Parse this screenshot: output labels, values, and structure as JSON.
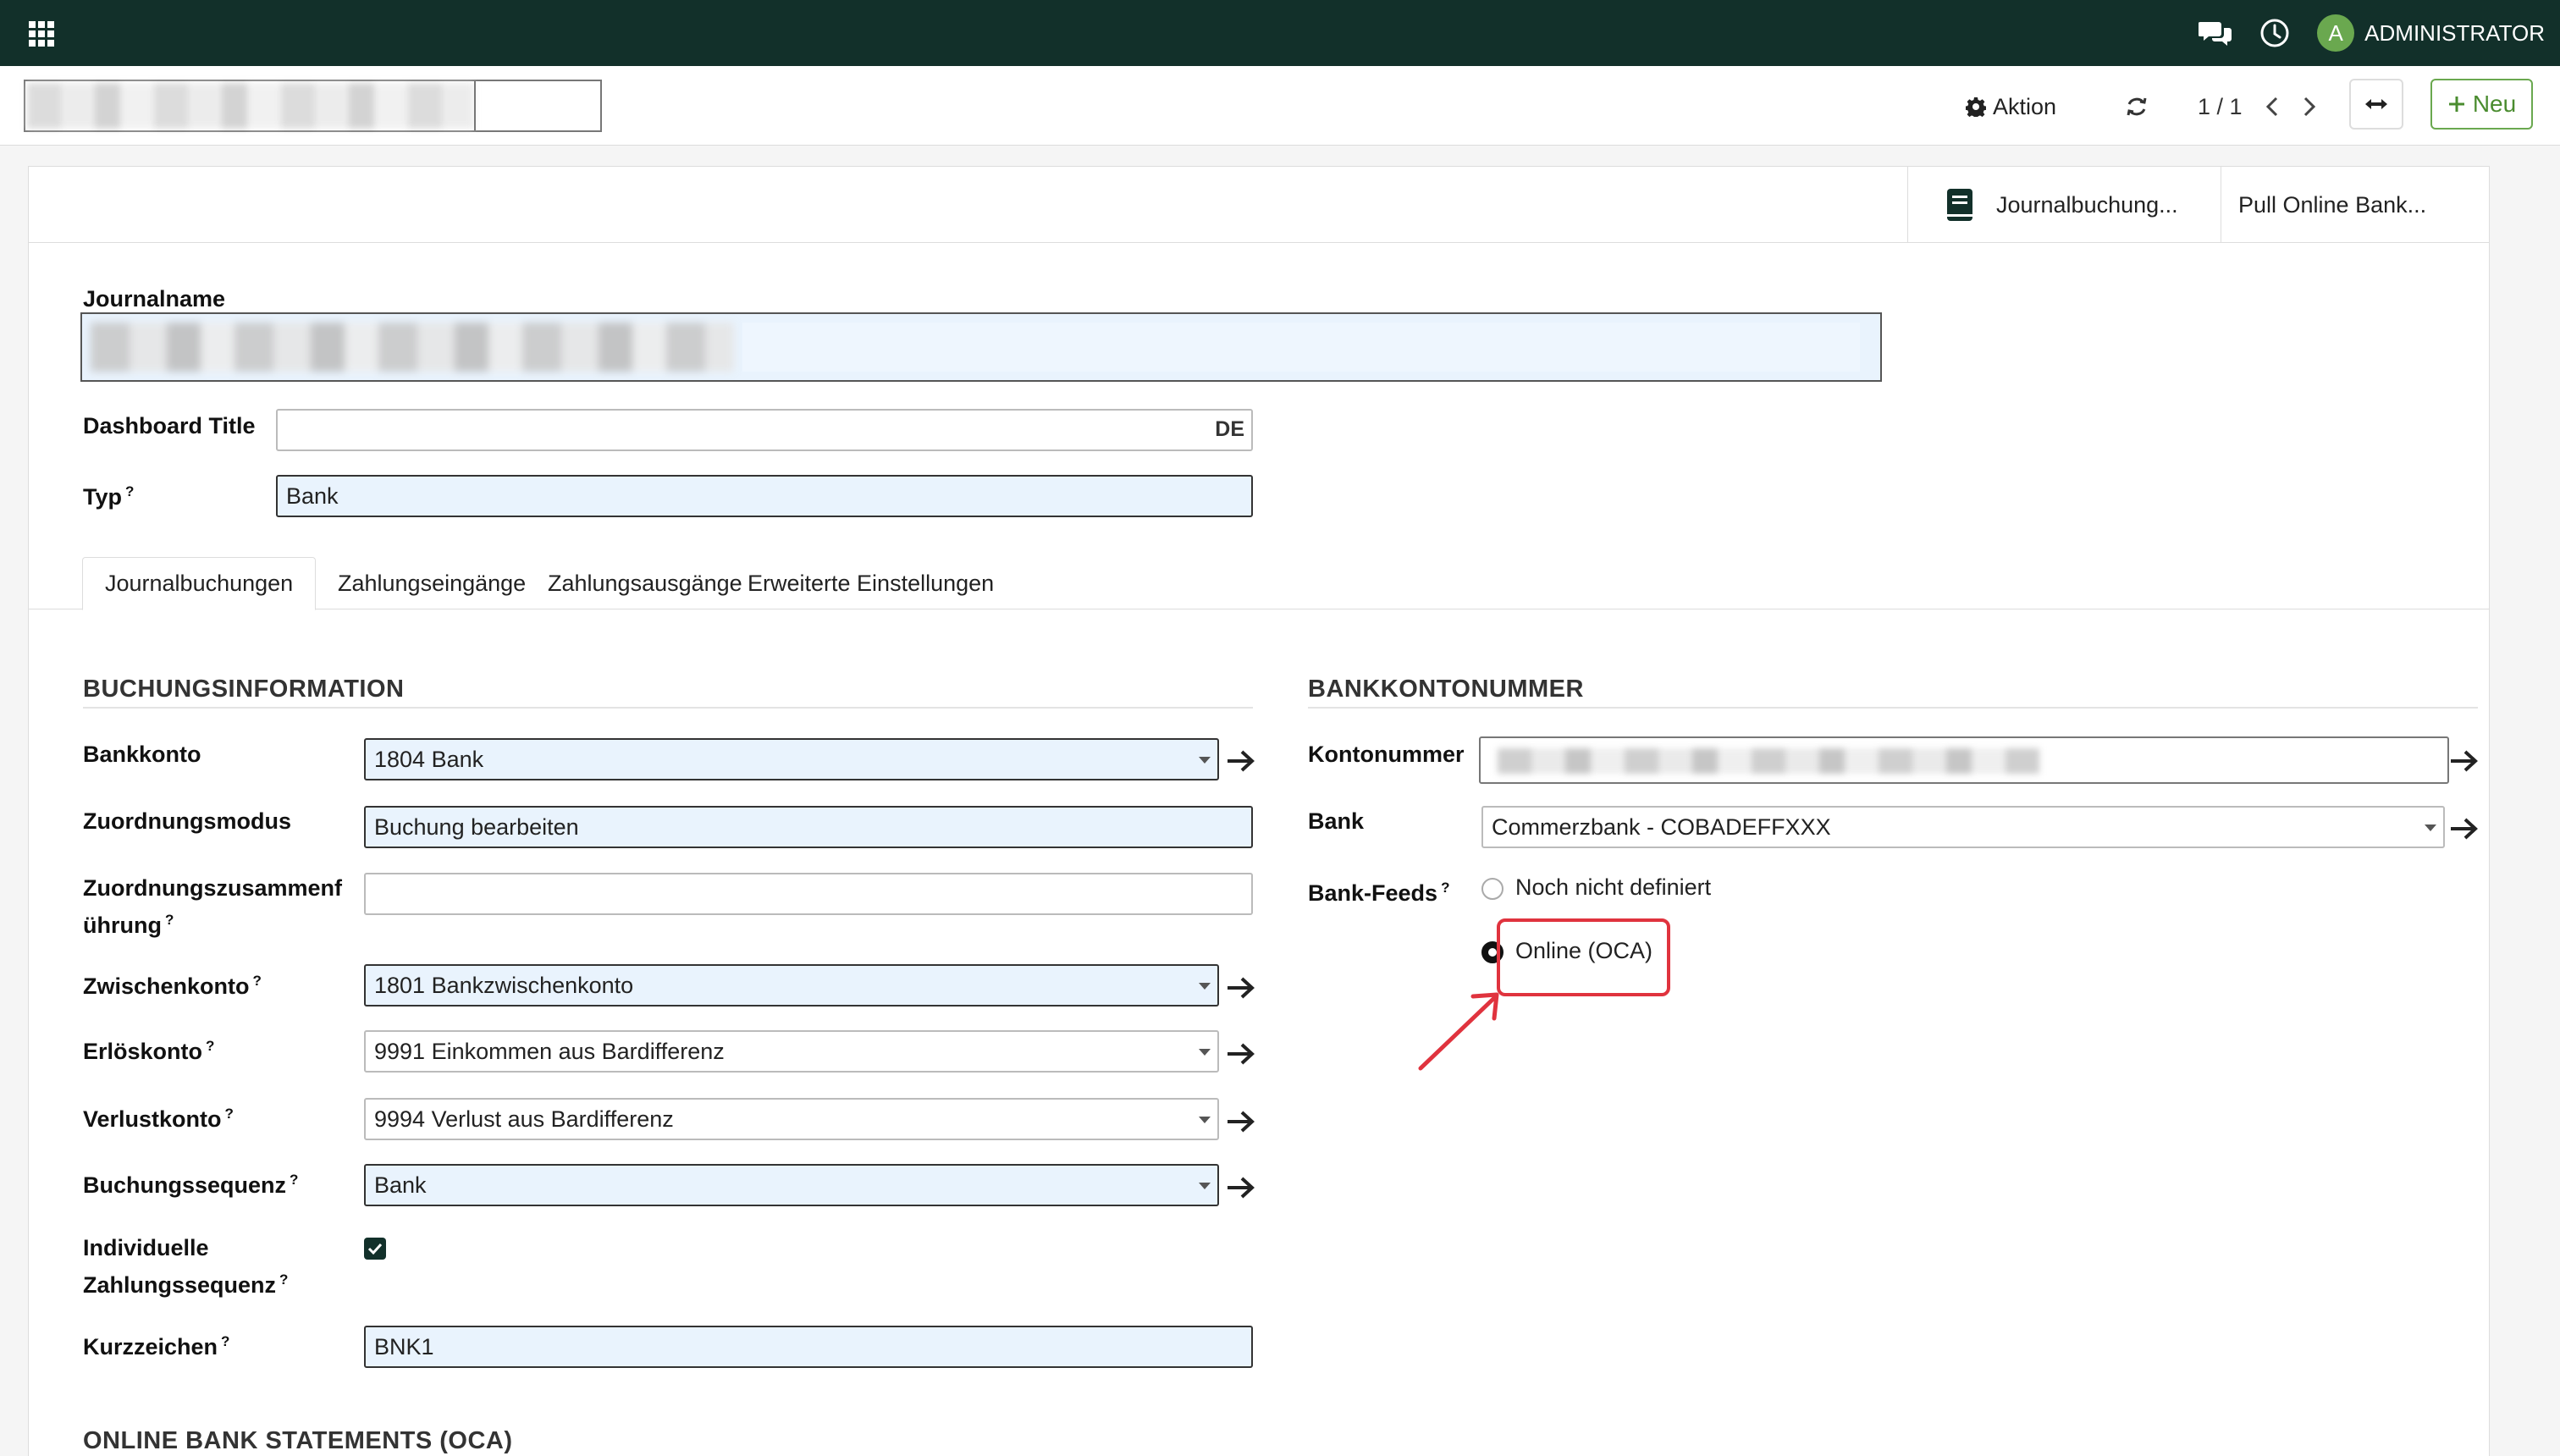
{
  "topbar": {
    "user_initial": "A",
    "user_name": "ADMINISTRATOR"
  },
  "control": {
    "action_label": "Aktion",
    "pager": "1 / 1",
    "new_label": "Neu"
  },
  "smart_buttons": {
    "journal_entries": "Journalbuchung...",
    "pull_bank": "Pull Online Bank..."
  },
  "form": {
    "journalname_label": "Journalname",
    "dashboard_title_label": "Dashboard Title",
    "dashboard_title_lang": "DE",
    "typ_label": "Typ",
    "typ_value": "Bank",
    "help_mark": "?"
  },
  "tabs": [
    {
      "label": "Journalbuchungen"
    },
    {
      "label": "Zahlungseingänge"
    },
    {
      "label": "Zahlungsausgänge"
    },
    {
      "label": "Erweiterte Einstellungen"
    }
  ],
  "booking": {
    "title": "BUCHUNGSINFORMATION",
    "bankkonto_label": "Bankkonto",
    "bankkonto_value": "1804 Bank",
    "zuordnungsmodus_label": "Zuordnungsmodus",
    "zuordnungsmodus_value": "Buchung bearbeiten",
    "zusammen_label_1": "Zuordnungszusammenf",
    "zusammen_label_2": "ührung",
    "zwischenkonto_label": "Zwischenkonto",
    "zwischenkonto_value": "1801 Bankzwischenkonto",
    "erloes_label": "Erlöskonto",
    "erloes_value": "9991 Einkommen aus Bardifferenz",
    "verlust_label": "Verlustkonto",
    "verlust_value": "9994 Verlust aus Bardifferenz",
    "sequenz_label": "Buchungssequenz",
    "sequenz_value": "Bank",
    "individuell_label_1": "Individuelle",
    "individuell_label_2": "Zahlungssequenz",
    "kurz_label": "Kurzzeichen",
    "kurz_value": "BNK1"
  },
  "bankaccount": {
    "title": "BANKKONTONUMMER",
    "kontonummer_label": "Kontonummer",
    "bank_label": "Bank",
    "bank_value": "Commerzbank - COBADEFFXXX",
    "feeds_label": "Bank-Feeds",
    "feeds_options": [
      "Noch nicht definiert",
      "Online (OCA)"
    ],
    "feeds_selected": "Online (OCA)"
  },
  "oca_section": {
    "title": "ONLINE BANK STATEMENTS (OCA)"
  },
  "colors": {
    "navbar": "#12302a",
    "accent_green": "#4a8c2f",
    "annotation_red": "#e0333e",
    "required_field": "#e9f3fd"
  }
}
